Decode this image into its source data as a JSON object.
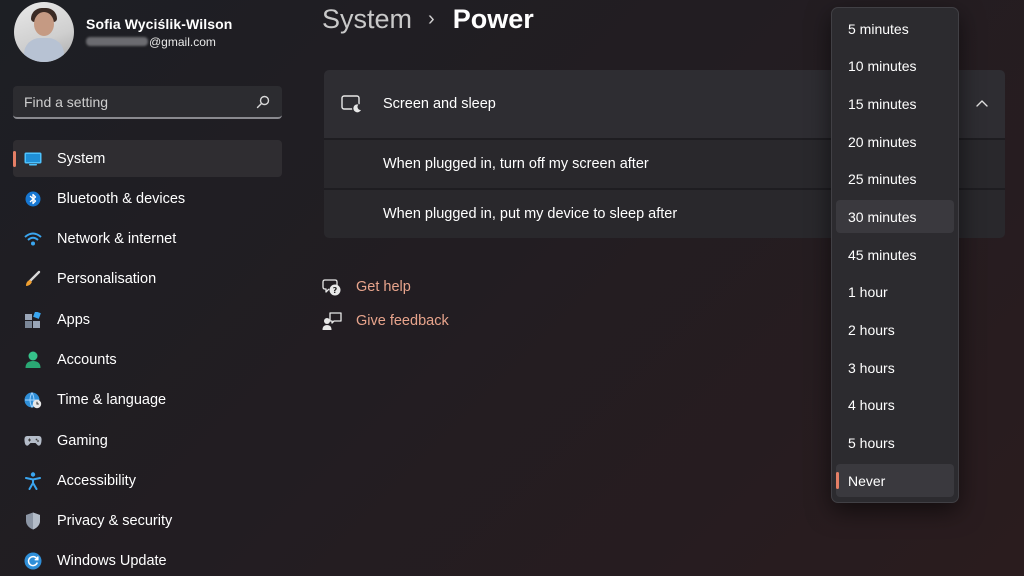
{
  "profile": {
    "name": "Sofia Wyciślik-Wilson",
    "email_domain": "@gmail.com"
  },
  "search": {
    "placeholder": "Find a setting"
  },
  "nav": [
    {
      "label": "System",
      "icon": "system-display-icon",
      "selected": true
    },
    {
      "label": "Bluetooth & devices",
      "icon": "bluetooth-icon"
    },
    {
      "label": "Network & internet",
      "icon": "wifi-icon"
    },
    {
      "label": "Personalisation",
      "icon": "brush-icon"
    },
    {
      "label": "Apps",
      "icon": "apps-icon"
    },
    {
      "label": "Accounts",
      "icon": "person-icon"
    },
    {
      "label": "Time & language",
      "icon": "globe-clock-icon"
    },
    {
      "label": "Gaming",
      "icon": "gamepad-icon"
    },
    {
      "label": "Accessibility",
      "icon": "accessibility-icon"
    },
    {
      "label": "Privacy & security",
      "icon": "shield-icon"
    },
    {
      "label": "Windows Update",
      "icon": "update-icon"
    }
  ],
  "breadcrumb": {
    "parent": "System",
    "separator": "›",
    "current": "Power"
  },
  "screen_sleep": {
    "title": "Screen and sleep",
    "rows": [
      "When plugged in, turn off my screen after",
      "When plugged in, put my device to sleep after"
    ]
  },
  "links": {
    "help": "Get help",
    "feedback": "Give feedback"
  },
  "dropdown": {
    "options": [
      "5 minutes",
      "10 minutes",
      "15 minutes",
      "20 minutes",
      "25 minutes",
      "30 minutes",
      "45 minutes",
      "1 hour",
      "2 hours",
      "3 hours",
      "4 hours",
      "5 hours",
      "Never"
    ],
    "hovered": "30 minutes",
    "selected": "Never"
  },
  "colors": {
    "accent": "#e57f66",
    "link": "#e8a48c",
    "card": "#2e2d32"
  }
}
